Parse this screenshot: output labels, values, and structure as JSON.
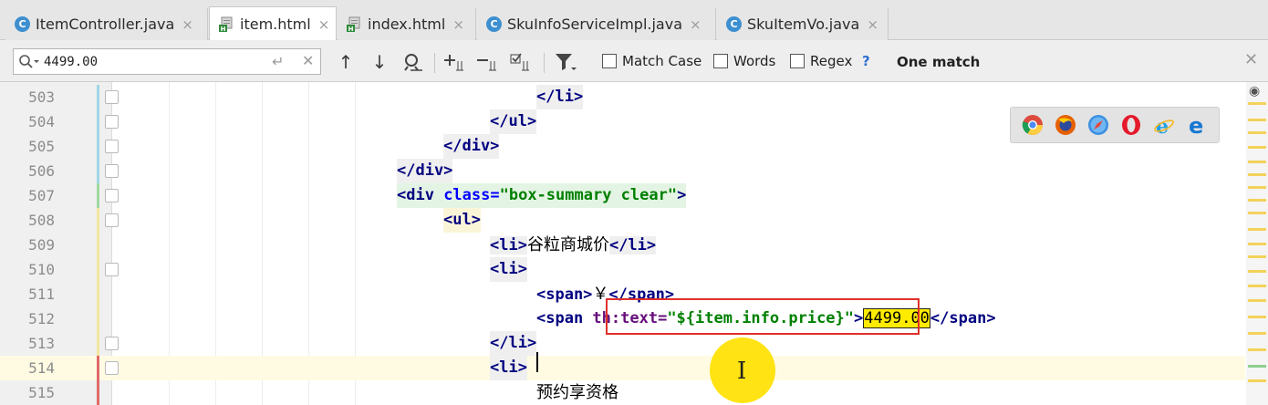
{
  "tabs": [
    {
      "label": "ItemController.java",
      "icon": "java-class-icon",
      "active": false
    },
    {
      "label": "item.html",
      "icon": "html-file-icon",
      "active": true
    },
    {
      "label": "index.html",
      "icon": "html-file-icon",
      "active": false
    },
    {
      "label": "SkuInfoServiceImpl.java",
      "icon": "java-class-icon",
      "active": false
    },
    {
      "label": "SkuItemVo.java",
      "icon": "java-class-icon",
      "active": false
    }
  ],
  "tab_close_glyph": "×",
  "find": {
    "query": "4499.00",
    "match_case_label": "Match Case",
    "words_label": "Words",
    "regex_label": "Regex",
    "help_label": "?",
    "result": "One match"
  },
  "editor": {
    "lines": [
      {
        "num": "503",
        "text": "</li>"
      },
      {
        "num": "504",
        "text": "</ul>"
      },
      {
        "num": "505",
        "text": "</div>"
      },
      {
        "num": "506",
        "text": "</div>"
      },
      {
        "num": "507",
        "text": "<div class=\"box-summary clear\">"
      },
      {
        "num": "508",
        "text": "<ul>"
      },
      {
        "num": "509",
        "text": "<li>谷粒商城价</li>"
      },
      {
        "num": "510",
        "text": "<li>"
      },
      {
        "num": "511",
        "text": "<span>￥</span>"
      },
      {
        "num": "512",
        "text": "<span th:text=\"${item.info.price}\">4499.00</span>"
      },
      {
        "num": "513",
        "text": "</li>"
      },
      {
        "num": "514",
        "text": "<li>"
      },
      {
        "num": "515",
        "text": "预约享资格"
      }
    ],
    "current_line": "514"
  },
  "colors": {
    "tag": "#000080",
    "attribute": "#0000ff",
    "string": "#008000",
    "thymeleaf": "#660e7a",
    "match_highlight": "#ffeb00",
    "annotation_box": "#e0302a",
    "cursor_highlight": "#ffe100"
  },
  "browser_icons": [
    "chrome-icon",
    "firefox-icon",
    "safari-icon",
    "opera-icon",
    "ie-icon",
    "edge-icon"
  ]
}
